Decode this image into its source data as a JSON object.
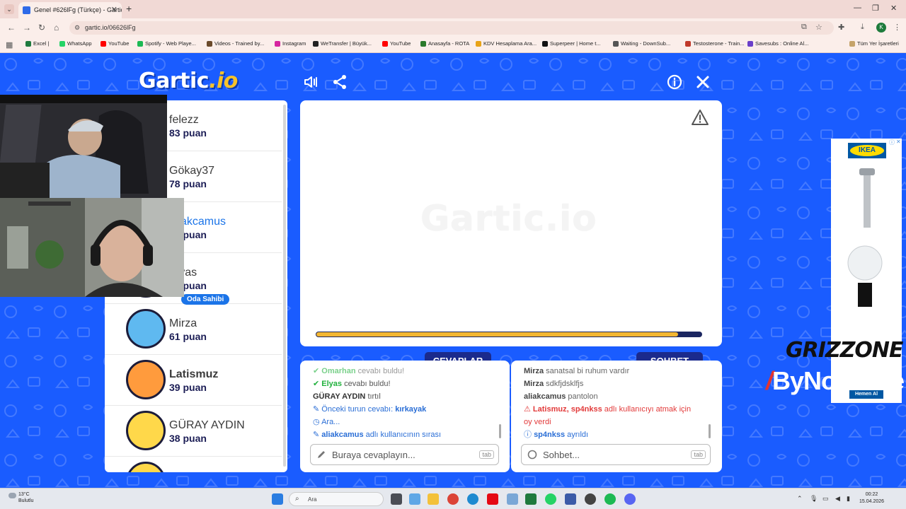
{
  "browser": {
    "tab_title": "Genel #626lFg (Türkçe) - Gartic",
    "url": "gartic.io/06626lFg",
    "bookmarks": [
      {
        "label": "Excel |",
        "color": "#1f7a3e"
      },
      {
        "label": "WhatsApp",
        "color": "#25d366"
      },
      {
        "label": "YouTube",
        "color": "#ff0000"
      },
      {
        "label": "Spotify - Web Playe...",
        "color": "#1db954"
      },
      {
        "label": "Videos - Trained by...",
        "color": "#6b4a2b"
      },
      {
        "label": "Instagram",
        "color": "#d6249f"
      },
      {
        "label": "WeTransfer | Büyük...",
        "color": "#222222"
      },
      {
        "label": "YouTube",
        "color": "#ff0000"
      },
      {
        "label": "Anasayfa - ROTA",
        "color": "#2b7a2b"
      },
      {
        "label": "KDV Hesaplama Ara...",
        "color": "#e8a317"
      },
      {
        "label": "Superpeer | Home t...",
        "color": "#111111"
      },
      {
        "label": "Waiting - DownSub...",
        "color": "#555555"
      },
      {
        "label": "Testosterone - Train...",
        "color": "#c0392b"
      },
      {
        "label": "Savesubs : Online Al...",
        "color": "#6a3fc9"
      }
    ],
    "all_bookmarks": "Tüm Yer İşaretleri"
  },
  "game": {
    "logo_main": "Gartic",
    "logo_suffix": ".io",
    "watermark": "Gartic.io",
    "timer_progress": 0.94,
    "players": [
      {
        "name": "felezz",
        "score": "83 puan",
        "avatar_color": "#d9c7a8",
        "owner": false
      },
      {
        "name": "Gökay37",
        "score": "78 puan",
        "avatar_color": "#c9e3f5",
        "owner": false
      },
      {
        "name": "aliakcamus",
        "score": "72 puan",
        "avatar_color": "#ffd7a1",
        "owner": false,
        "highlight": true
      },
      {
        "name": "Elyas",
        "score": "64 puan",
        "avatar_color": "#ffcb57",
        "owner": true
      },
      {
        "name": "Mirza",
        "score": "61 puan",
        "avatar_color": "#5fb9f0",
        "owner": false
      },
      {
        "name": "Latismuz",
        "score": "39 puan",
        "avatar_color": "#ff9b3d",
        "owner": false,
        "bold": true
      },
      {
        "name": "GÜRAY AYDIN",
        "score": "38 puan",
        "avatar_color": "#ffd84a",
        "owner": false
      }
    ],
    "owner_label": "Oda Sahibi"
  },
  "answers": {
    "title": "CEVAPLAR",
    "messages": [
      {
        "user": "Omarhan",
        "text": " cevabı buldu!",
        "cls": "green",
        "icon": "check-icon"
      },
      {
        "user": "Elyas",
        "text": " cevabı buldu!",
        "cls": "green",
        "icon": "check-icon"
      },
      {
        "user": "GÜRAY AYDIN",
        "text": " tırtıl",
        "cls": "dark",
        "icon": ""
      },
      {
        "user": "",
        "text": "Önceki turun cevabı: ",
        "extra": "kırkayak",
        "cls": "blue",
        "icon": "pencil-icon"
      },
      {
        "user": "",
        "text": "Ara...",
        "cls": "blue",
        "icon": "clock-icon"
      },
      {
        "user": "aliakcamus",
        "text": " adlı kullanıcının sırası",
        "cls": "blue",
        "icon": "pencil-icon"
      }
    ],
    "placeholder": "Buraya cevaplayın...",
    "tab_key": "tab"
  },
  "chat": {
    "title": "SOHBET",
    "messages": [
      {
        "user": "Mirza",
        "text": " sanatsal bi ruhum vardır",
        "cls": "dark"
      },
      {
        "user": "Mirza",
        "text": " sdkfjdsklfjs",
        "cls": "dark"
      },
      {
        "user": "aliakcamus",
        "text": " pantolon",
        "cls": "dark"
      },
      {
        "user": "Latismuz, sp4nkss",
        "text": " adlı kullanıcıyı atmak için",
        "cls": "red",
        "icon": "alert-icon"
      },
      {
        "user": "",
        "text": "oy verdi",
        "cls": "red"
      },
      {
        "user": "sp4nkss",
        "text": " ayrıldı",
        "cls": "blue",
        "icon": "info-icon"
      }
    ],
    "placeholder": "Sohbet...",
    "tab_key": "tab"
  },
  "ad": {
    "brand": "IKEA",
    "button": "Hemen Al"
  },
  "overlay": {
    "grizz": "GRIZZONE",
    "sponsor": "ByNoGame"
  },
  "taskbar": {
    "temp": "13°C",
    "weather": "Bulutlu",
    "search": "Ara",
    "time": "00:22",
    "date": "15.04.2026"
  }
}
